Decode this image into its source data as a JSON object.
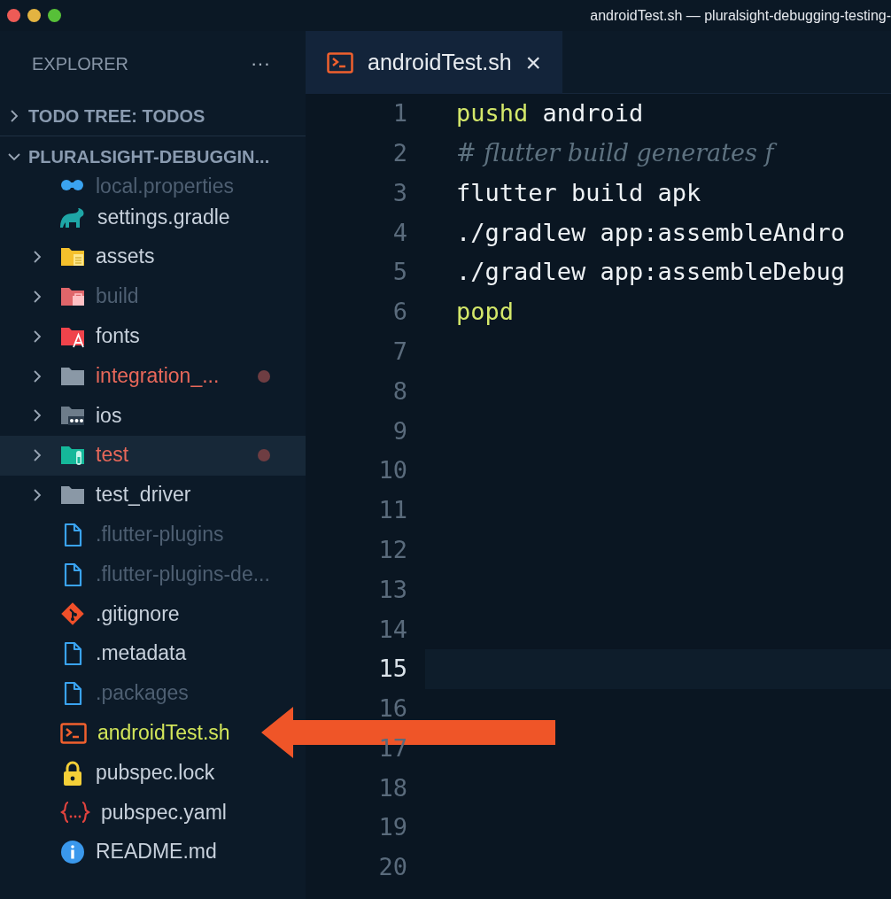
{
  "window": {
    "title": "androidTest.sh — pluralsight-debugging-testing-"
  },
  "sidebar": {
    "title": "EXPLORER",
    "more": "···",
    "sections": [
      {
        "label": "TODO TREE: TODOS",
        "expanded": false
      },
      {
        "label": "PLURALSIGHT-DEBUGGIN...",
        "expanded": true
      }
    ],
    "tree": [
      {
        "kind": "group",
        "children": [
          {
            "label": "local.properties",
            "kind": "properties",
            "color": "#4e5f72",
            "dot": false,
            "selected": false
          },
          {
            "label": "settings.gradle",
            "kind": "gradle",
            "color": "#c8d1dc",
            "dot": false,
            "selected": false
          }
        ]
      },
      {
        "label": "assets",
        "kind": "assets-folder",
        "expanded": false,
        "color": "#c8d1dc",
        "dot": false,
        "selected": false
      },
      {
        "label": "build",
        "kind": "build-folder",
        "expanded": false,
        "color": "#4e5f72",
        "dot": false,
        "selected": false
      },
      {
        "label": "fonts",
        "kind": "fonts-folder",
        "expanded": false,
        "color": "#c8d1dc",
        "dot": false,
        "selected": false
      },
      {
        "label": "integration_...",
        "kind": "folder",
        "expanded": false,
        "color": "#e8685a",
        "dot": true,
        "selected": false
      },
      {
        "label": "ios",
        "kind": "ios-folder",
        "expanded": false,
        "color": "#c8d1dc",
        "dot": false,
        "selected": false
      },
      {
        "label": "test",
        "kind": "test-folder",
        "expanded": false,
        "color": "#e8685a",
        "dot": true,
        "selected": true
      },
      {
        "label": "test_driver",
        "kind": "folder",
        "expanded": false,
        "color": "#c8d1dc",
        "dot": false,
        "selected": false
      },
      {
        "label": ".flutter-plugins",
        "kind": "file",
        "color": "#4e5f72",
        "dot": false,
        "selected": false
      },
      {
        "label": ".flutter-plugins-de...",
        "kind": "file",
        "color": "#4e5f72",
        "dot": false,
        "selected": false
      },
      {
        "label": ".gitignore",
        "kind": "git",
        "color": "#c8d1dc",
        "dot": false,
        "selected": false
      },
      {
        "label": ".metadata",
        "kind": "file",
        "color": "#c8d1dc",
        "dot": false,
        "selected": false
      },
      {
        "label": ".packages",
        "kind": "file",
        "color": "#4e5f72",
        "dot": false,
        "selected": false
      },
      {
        "label": "androidTest.sh",
        "kind": "shell",
        "color": "#d3e65a",
        "dot": false,
        "selected": false
      },
      {
        "label": "pubspec.lock",
        "kind": "lock",
        "color": "#c8d1dc",
        "dot": false,
        "selected": false
      },
      {
        "label": "pubspec.yaml",
        "kind": "yaml",
        "color": "#c8d1dc",
        "dot": false,
        "selected": false
      },
      {
        "label": "README.md",
        "kind": "readme",
        "color": "#c8d1dc",
        "dot": false,
        "selected": false
      }
    ]
  },
  "tabs": [
    {
      "label": "androidTest.sh",
      "kind": "shell",
      "selected": true,
      "close": "×"
    }
  ],
  "editor": {
    "lines": [
      {
        "number": "1",
        "current": false,
        "tokens": [
          {
            "text": "pushd",
            "kind": "command"
          },
          {
            "text": " android",
            "kind": "plain"
          }
        ]
      },
      {
        "number": "2",
        "current": false,
        "tokens": [
          {
            "text": "# flutter build generates f",
            "kind": "comment"
          }
        ]
      },
      {
        "number": "3",
        "current": false,
        "tokens": [
          {
            "text": "flutter build apk",
            "kind": "plain"
          }
        ]
      },
      {
        "number": "4",
        "current": false,
        "tokens": [
          {
            "text": "./gradlew app:assembleAndro",
            "kind": "plain"
          }
        ]
      },
      {
        "number": "5",
        "current": false,
        "tokens": [
          {
            "text": "./gradlew app:assembleDebug",
            "kind": "plain"
          }
        ]
      },
      {
        "number": "6",
        "current": false,
        "tokens": [
          {
            "text": "popd",
            "kind": "command"
          }
        ]
      },
      {
        "number": "7",
        "current": false
      },
      {
        "number": "8",
        "current": false
      },
      {
        "number": "9",
        "current": false
      },
      {
        "number": "10",
        "current": false
      },
      {
        "number": "11",
        "current": false
      },
      {
        "number": "12",
        "current": false
      },
      {
        "number": "13",
        "current": false
      },
      {
        "number": "14",
        "current": false
      },
      {
        "number": "15",
        "current": true
      },
      {
        "number": "16",
        "current": false
      },
      {
        "number": "17",
        "current": false
      },
      {
        "number": "18",
        "current": false
      },
      {
        "number": "19",
        "current": false
      },
      {
        "number": "20",
        "current": false
      }
    ]
  }
}
